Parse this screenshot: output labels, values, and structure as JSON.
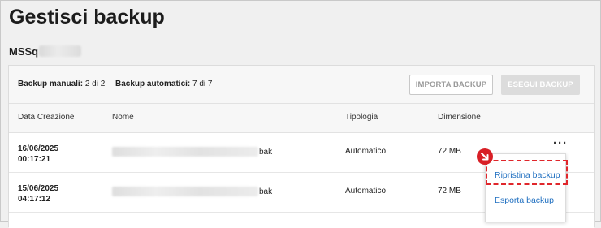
{
  "page": {
    "title": "Gestisci backup"
  },
  "device": {
    "name": "MSSq"
  },
  "toolbar": {
    "manual_label": "Backup manuali:",
    "manual_value": "2 di 2",
    "auto_label": "Backup automatici:",
    "auto_value": "7 di 7",
    "import_label": "IMPORTA BACKUP",
    "run_label": "ESEGUI BACKUP"
  },
  "table": {
    "columns": [
      "Data Creazione",
      "Nome",
      "Tipologia",
      "Dimensione"
    ],
    "rows": [
      {
        "date": "16/06/2025",
        "time": "00:17:21",
        "name_ext": "bak",
        "type": "Automatico",
        "size": "72 MB"
      },
      {
        "date": "15/06/2025",
        "time": "04:17:12",
        "name_ext": "bak",
        "type": "Automatico",
        "size": "72 MB"
      }
    ]
  },
  "menu": {
    "items": [
      "Ripristina backup",
      "Esporta backup"
    ]
  },
  "colors": {
    "accent_link": "#1f6fc0",
    "highlight": "#e0262b",
    "badge": "#d81f26"
  }
}
